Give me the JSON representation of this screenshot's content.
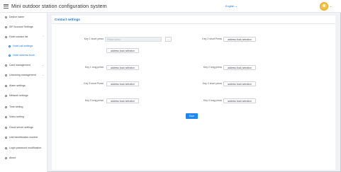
{
  "header": {
    "title": "Mini outdoor station configuration system",
    "language": "English",
    "menu_icon": "hamburger-icon",
    "user_caret": "⌄"
  },
  "sidebar": {
    "items": [
      {
        "label": "Device name",
        "icon": "device-icon"
      },
      {
        "label": "SIP Account Settings",
        "icon": "sip-icon"
      },
      {
        "label": "Hotel contact list",
        "icon": "contact-icon",
        "expandable": true
      },
      {
        "label": "Hotel call settings",
        "icon": "call-icon",
        "sub": true
      },
      {
        "label": "Hotel address book",
        "icon": "book-icon",
        "sub": true
      },
      {
        "label": "Card management",
        "icon": "card-icon",
        "expandable": true
      },
      {
        "label": "Unlocking management",
        "icon": "unlock-icon",
        "expandable": true
      },
      {
        "label": "Alarm settings",
        "icon": "alarm-icon"
      },
      {
        "label": "Network settings",
        "icon": "network-icon"
      },
      {
        "label": "Time setting",
        "icon": "clock-icon"
      },
      {
        "label": "Video setting",
        "icon": "video-icon"
      },
      {
        "label": "Cloud server settings",
        "icon": "cloud-icon"
      },
      {
        "label": "Unit identification number",
        "icon": "id-icon"
      },
      {
        "label": "Login password modification",
        "icon": "lock-icon"
      },
      {
        "label": "About",
        "icon": "info-icon"
      }
    ]
  },
  "main": {
    "section_title": "Contact settings",
    "fields": {
      "key1_short": {
        "label": "Key 1 short press",
        "placeholder": "Please select",
        "dots": "...",
        "button": "address book selection"
      },
      "key2_short": {
        "label": "Key 2 short Press",
        "button": "address book selection"
      },
      "key1_long": {
        "label": "Key 1 long press",
        "button": "address book selection"
      },
      "key2_long": {
        "label": "Key 2 long press",
        "button": "address book selection"
      },
      "key3_short": {
        "label": "Key 3 short Press",
        "button": "address book selection"
      },
      "key4_short": {
        "label": "Key 4 short press",
        "button": "address book selection"
      },
      "key3_long": {
        "label": "Key 3 long press",
        "button": "address book selection"
      },
      "key4_long": {
        "label": "Key 4 long press",
        "button": "address book selection"
      }
    },
    "save_label": "Save"
  },
  "colors": {
    "accent": "#1e87f0",
    "link": "#1f78d1",
    "avatar": "#f5c242"
  }
}
